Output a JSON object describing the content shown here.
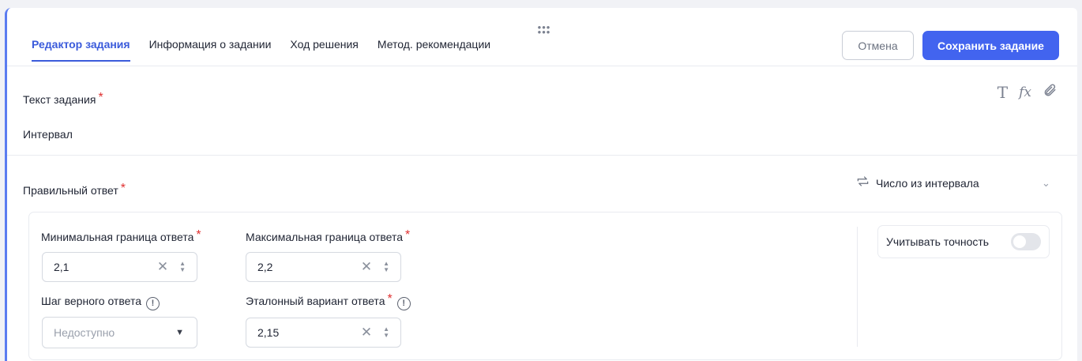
{
  "header": {
    "tabs": [
      {
        "label": "Редактор задания",
        "active": true
      },
      {
        "label": "Информация о задании",
        "active": false
      },
      {
        "label": "Ход решения",
        "active": false
      },
      {
        "label": "Метод. рекомендации",
        "active": false
      }
    ],
    "cancel_label": "Отмена",
    "save_label": "Сохранить задание"
  },
  "task": {
    "label": "Текст задания",
    "required_mark": "*",
    "value": "Интервал",
    "toolbar": [
      "text-icon",
      "formula-icon",
      "attach-icon"
    ]
  },
  "answer": {
    "label": "Правильный ответ",
    "required_mark": "*",
    "type_label": "Число из интервала",
    "min": {
      "label": "Минимальная граница ответа",
      "value": "2,1"
    },
    "max": {
      "label": "Максимальная граница ответа",
      "value": "2,2"
    },
    "step": {
      "label": "Шаг верного ответа",
      "value": "Недоступно"
    },
    "reference": {
      "label": "Эталонный вариант ответа",
      "value": "2,15"
    },
    "precision_label": "Учитывать точность",
    "precision_enabled": false
  },
  "colors": {
    "accent": "#4264ef",
    "required": "#e03131"
  }
}
